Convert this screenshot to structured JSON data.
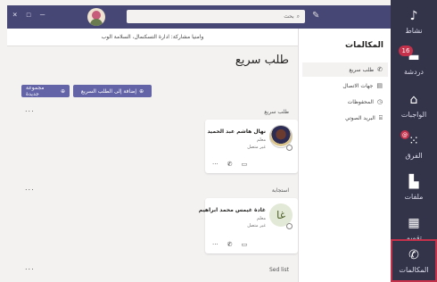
{
  "titlebar": {
    "window_controls": [
      "×",
      "☐",
      "–"
    ],
    "search_placeholder": "بحث",
    "compose_icon": "compose-icon"
  },
  "rail": {
    "items": [
      {
        "label": "نشاط",
        "icon": "bell-icon"
      },
      {
        "label": "دردشة",
        "icon": "chat-icon",
        "badge": "16"
      },
      {
        "label": "الواجبات",
        "icon": "assignments-icon"
      },
      {
        "label": "الفرق",
        "icon": "teams-icon",
        "badge": "@"
      },
      {
        "label": "ملفات",
        "icon": "files-icon"
      },
      {
        "label": "تقويم",
        "icon": "calendar-icon"
      },
      {
        "label": "المكالمات",
        "icon": "phone-icon",
        "active": true
      }
    ]
  },
  "banner": {
    "text": "وامنيا مشاركة: ادارة التسكنمال، السلامة الوب"
  },
  "subnav": {
    "title": "المكالمات",
    "items": [
      {
        "label": "طلب سريع",
        "icon": "phone-icon",
        "selected": true
      },
      {
        "label": "جهات الاتصال",
        "icon": "contacts-icon"
      },
      {
        "label": "المحفوظات",
        "icon": "history-icon"
      },
      {
        "label": "البريد الصوتي",
        "icon": "voicemail-icon"
      }
    ]
  },
  "main": {
    "title": "طلب سريع",
    "add_button": "إضافة إلى الطلب السريع",
    "new_group_button": "مجموعة جديدة",
    "sections": [
      {
        "label": "طلب سريع",
        "card": {
          "name": "نهال هاشم عبد الحميد",
          "sub1": "معلم",
          "sub2": "غير متصل"
        }
      },
      {
        "label": "استجابة",
        "card": {
          "name": "غادة غيمس محمد ابراهيم",
          "sub1": "معلم",
          "sub2": "غير متصل",
          "initials": "غا"
        }
      },
      {
        "label": "Sed list"
      }
    ],
    "more": "..."
  }
}
